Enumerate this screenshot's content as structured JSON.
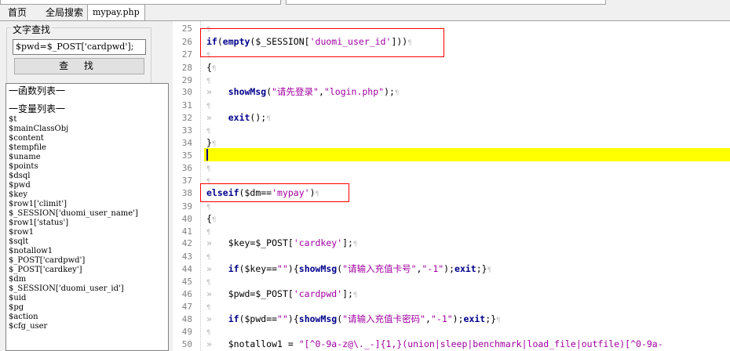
{
  "tabs": [
    {
      "label": "首页",
      "active": false
    },
    {
      "label": "全局搜索",
      "active": false
    },
    {
      "label": "mypay.php",
      "active": true
    }
  ],
  "find": {
    "group_title": "文字查找",
    "input_value": "$pwd=$_POST['cardpwd'];",
    "button_label": "查 找"
  },
  "symbols": {
    "functions_header": "一函数列表一",
    "variables_header": "一变量列表一",
    "variables": [
      "$t",
      "$mainClassObj",
      "$content",
      "$tempfile",
      "$uname",
      "$points",
      "$dsql",
      "$pwd",
      "$key",
      "$row1['climit']",
      "$_SESSION['duomi_user_name']",
      "$row1['status']",
      "$row1",
      "$sqlt",
      "$notallow1",
      "$_POST['cardpwd']",
      "$_POST['cardkey']",
      "$dm",
      "$_SESSION['duomi_user_id']",
      "$uid",
      "$pg",
      "$action",
      "$cfg_user"
    ]
  },
  "editor": {
    "highlight_color": "#ffff00",
    "annotation_color": "#ff0000",
    "line_numbers": [
      "25",
      "26",
      "27",
      "28",
      "29",
      "30",
      "31",
      "32",
      "33",
      "34",
      "35",
      "36",
      "37",
      "38",
      "39",
      "40",
      "41",
      "42",
      "43",
      "44",
      "45",
      "46",
      "47",
      "48",
      "49",
      "50"
    ],
    "lines": {
      "l26_kw": "if",
      "l26_a": "(",
      "l26_fn": "empty",
      "l26_b": "($_SESSION[",
      "l26_str": "'duomi_user_id'",
      "l26_c": "]))",
      "l28": "{",
      "l30_fn": "showMsg",
      "l30_a": "(",
      "l30_s1": "\"请先登录\"",
      "l30_b": ",",
      "l30_s2": "\"login.php\"",
      "l30_c": ");",
      "l32_fn": "exit",
      "l32_a": "();",
      "l34": "}",
      "l38_kw": "elseif",
      "l38_a": "($dm==",
      "l38_str": "'mypay'",
      "l38_b": ")",
      "l40": "{",
      "l42_a": "$key=$_POST[",
      "l42_str": "'cardkey'",
      "l42_b": "];",
      "l44_kw": "if",
      "l44_a": "($key==",
      "l44_s0": "\"\"",
      "l44_b": "){",
      "l44_fn": "showMsg",
      "l44_c": "(",
      "l44_s1": "\"请输入充值卡号\"",
      "l44_d": ",",
      "l44_s2": "\"-1\"",
      "l44_e": ");",
      "l44_fn2": "exit",
      "l44_f": ";}",
      "l46_a": "$pwd=$_POST[",
      "l46_str": "'cardpwd'",
      "l46_b": "];",
      "l48_kw": "if",
      "l48_a": "($pwd==",
      "l48_s0": "\"\"",
      "l48_b": "){",
      "l48_fn": "showMsg",
      "l48_c": "(",
      "l48_s1": "\"请输入充值卡密码\"",
      "l48_d": ",",
      "l48_s2": "\"-1\"",
      "l48_e": ");",
      "l48_fn2": "exit",
      "l48_f": ";}",
      "l50_a": "$notallow1 = ",
      "l50_str": "\"[^0-9a-z@\\._-]{1,}(union|sleep|benchmark|load_file|outfile)[^0-9a-"
    },
    "pilcrow": "¶",
    "arrow": "»"
  }
}
